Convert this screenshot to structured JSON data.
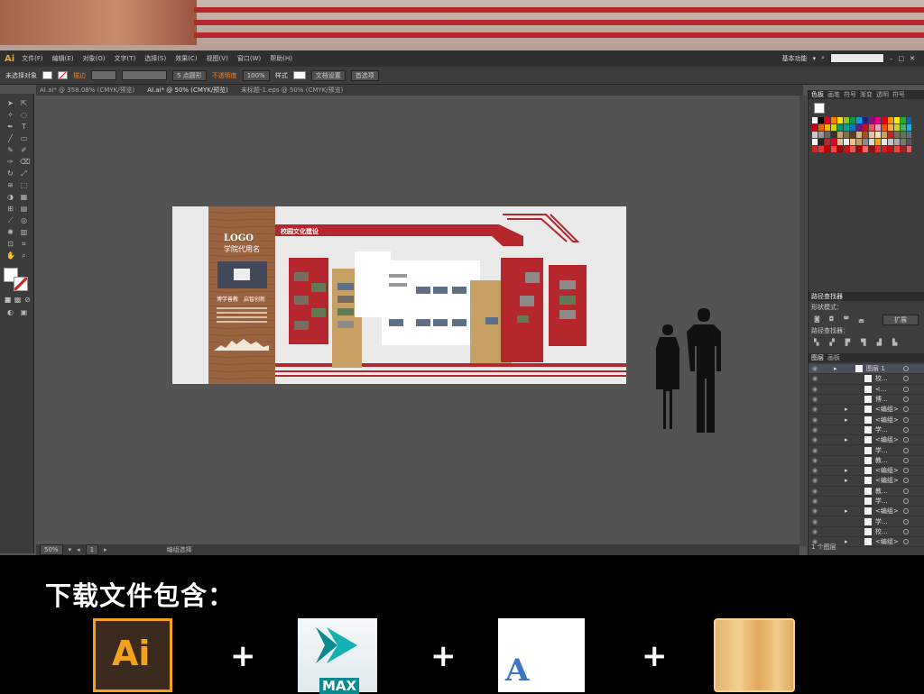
{
  "app": {
    "logo": "Ai",
    "menu": [
      "文件(F)",
      "编辑(E)",
      "对象(O)",
      "文字(T)",
      "选择(S)",
      "效果(C)",
      "视图(V)",
      "窗口(W)",
      "帮助(H)"
    ],
    "workspace": "基本功能"
  },
  "controlbar": {
    "selection": "未选择对象",
    "stroke_label": "描边",
    "brush_value": "5 点圆形",
    "opacity_label": "不透明度",
    "opacity_value": "100%",
    "style_label": "样式",
    "doc_setup": "文档设置",
    "preferences": "首选项"
  },
  "tabs": [
    {
      "label": "AI.ai* @ 358.08% (CMYK/预览)",
      "active": false
    },
    {
      "label": "AI.ai* @ 50% (CMYK/预览)",
      "active": true
    },
    {
      "label": "未标题-1.eps @ 50% (CMYK/预览)",
      "active": false
    }
  ],
  "artwork": {
    "logo_text": "LOGO",
    "school_name": "学院代用名",
    "motto": "博学善教　启智创新",
    "main_title": "校园文化建设"
  },
  "status": {
    "zoom": "50%",
    "page": "1",
    "tool": "编组选择"
  },
  "panels": {
    "swatch_tabs": [
      "色板",
      "画笔",
      "符号",
      "渐变",
      "透明",
      "符号"
    ],
    "pathfinder_title": "路径查找器",
    "shape_modes": "形状模式：",
    "expand": "扩展",
    "pathfinder_label": "路径查找器：",
    "layer_tabs": [
      "图层",
      "画板"
    ],
    "layers": [
      {
        "name": "图层 1",
        "expand": true
      },
      {
        "name": "校...",
        "expand": false
      },
      {
        "name": "<...",
        "expand": false
      },
      {
        "name": "博...",
        "expand": false
      },
      {
        "name": "<编组>",
        "expand": true
      },
      {
        "name": "<编组>",
        "expand": true
      },
      {
        "name": "学...",
        "expand": false
      },
      {
        "name": "<编组>",
        "expand": true
      },
      {
        "name": "学...",
        "expand": false
      },
      {
        "name": "教...",
        "expand": false
      },
      {
        "name": "<编组>",
        "expand": true
      },
      {
        "name": "<编组>",
        "expand": true
      },
      {
        "name": "教...",
        "expand": false
      },
      {
        "name": "学...",
        "expand": false
      },
      {
        "name": "<编组>",
        "expand": true
      },
      {
        "name": "学...",
        "expand": false
      },
      {
        "name": "校...",
        "expand": false
      },
      {
        "name": "<编组>",
        "expand": true
      }
    ],
    "layer_count": "1 个图层"
  },
  "footer": {
    "heading": "下载文件包含：",
    "plus": "+",
    "ai_label": "Ai",
    "max_label": "MAX",
    "font_label": "A"
  },
  "colors": {
    "accent_red": "#b5262d",
    "wood": "#9a6440",
    "gold": "#c9a063",
    "ai_orange": "#f4a21c"
  }
}
